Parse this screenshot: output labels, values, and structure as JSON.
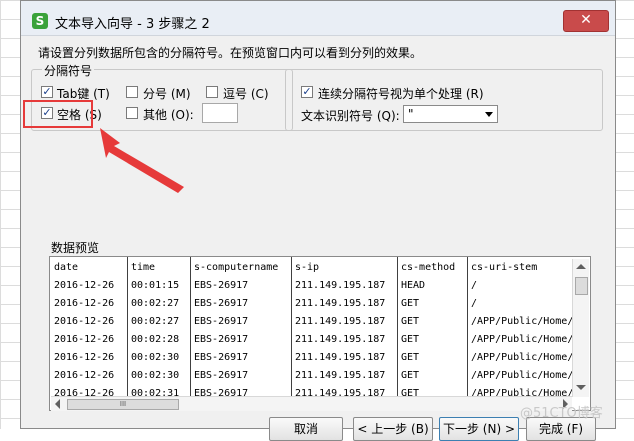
{
  "window": {
    "title": "文本导入向导 - 3 步骤之 2",
    "app_icon_letter": "S",
    "close_glyph": "✕"
  },
  "instruction": "请设置分列数据所包含的分隔符号。在预览窗口内可以看到分列的效果。",
  "delimiters": {
    "legend": "分隔符号",
    "tab": {
      "label": "Tab键 (T)",
      "checked": true
    },
    "semicolon": {
      "label": "分号 (M)",
      "checked": false
    },
    "comma": {
      "label": "逗号 (C)",
      "checked": false
    },
    "space": {
      "label": "空格 (S)",
      "checked": true
    },
    "other": {
      "label": "其他 (O):",
      "checked": false,
      "value": ""
    }
  },
  "options": {
    "consecutive": {
      "label": "连续分隔符号视为单个处理 (R)",
      "checked": true
    },
    "qualifier_label": "文本识别符号 (Q):",
    "qualifier_value": "\""
  },
  "preview": {
    "label": "数据预览",
    "columns": [
      "date",
      "time",
      "s-computername",
      "s-ip",
      "cs-method",
      "cs-uri-stem"
    ],
    "rows": [
      [
        "2016-12-26",
        "00:01:15",
        "EBS-26917",
        "211.149.195.187",
        "HEAD",
        "/"
      ],
      [
        "2016-12-26",
        "00:02:27",
        "EBS-26917",
        "211.149.195.187",
        "GET",
        "/"
      ],
      [
        "2016-12-26",
        "00:02:27",
        "EBS-26917",
        "211.149.195.187",
        "GET",
        "/APP/Public/Home/"
      ],
      [
        "2016-12-26",
        "00:02:28",
        "EBS-26917",
        "211.149.195.187",
        "GET",
        "/APP/Public/Home/"
      ],
      [
        "2016-12-26",
        "00:02:30",
        "EBS-26917",
        "211.149.195.187",
        "GET",
        "/APP/Public/Home/"
      ],
      [
        "2016-12-26",
        "00:02:30",
        "EBS-26917",
        "211.149.195.187",
        "GET",
        "/APP/Public/Home/"
      ],
      [
        "2016-12-26",
        "00:02:31",
        "EBS-26917",
        "211.149.195.187",
        "GET",
        "/APP/Public/Home/"
      ]
    ],
    "hscroll_thumb": "III"
  },
  "buttons": {
    "cancel": "取消",
    "back": "< 上一步 (B)",
    "next": "下一步 (N) >",
    "finish": "完成 (F)"
  },
  "watermark": "@51CTO博客",
  "colors": {
    "highlight": "#e63a3a"
  }
}
